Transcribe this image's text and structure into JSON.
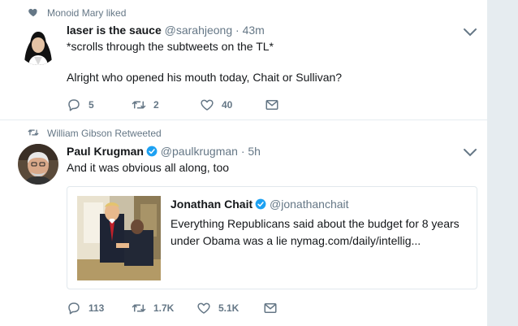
{
  "tweets": [
    {
      "context": "Monoid Mary liked",
      "context_icon": "heart-icon",
      "name": "laser is the sauce",
      "handle": "@sarahjeong",
      "time": "· 43m",
      "verified": false,
      "text": "*scrolls through the subtweets on the TL*\n\nAlright who opened his mouth today, Chait or Sullivan?",
      "replies": "5",
      "retweets": "2",
      "likes": "40"
    },
    {
      "context": "William Gibson Retweeted",
      "context_icon": "retweet-icon",
      "name": "Paul Krugman",
      "handle": "@paulkrugman",
      "time": "· 5h",
      "verified": true,
      "text": "And it was obvious all along, too",
      "quote": {
        "name": "Jonathan Chait",
        "handle": "@jonathanchait",
        "verified": true,
        "text": "Everything Republicans said about the budget for 8 years under Obama was a lie nymag.com/daily/intellig..."
      },
      "replies": "113",
      "retweets": "1.7K",
      "likes": "5.1K"
    }
  ],
  "colors": {
    "text_primary": "#14171a",
    "text_secondary": "#657786",
    "verified_blue": "#1da1f2",
    "border": "#e6ecf0"
  }
}
